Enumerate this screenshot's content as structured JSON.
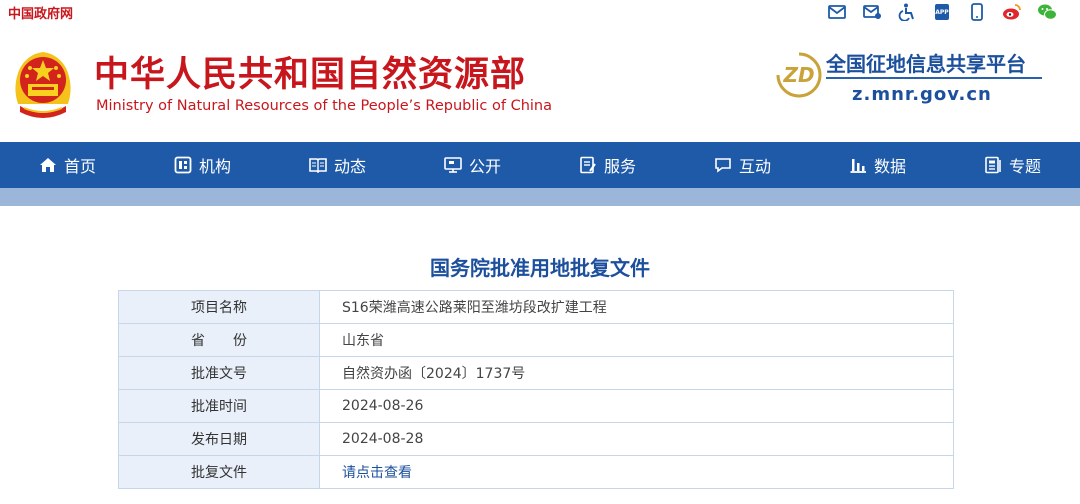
{
  "topbar": {
    "gov_link": "中国政府网",
    "icons": [
      "mail-icon",
      "mailbox-icon",
      "accessibility-icon",
      "app-icon",
      "mobile-icon",
      "weibo-icon",
      "wechat-icon"
    ]
  },
  "header": {
    "title_cn": "中华人民共和国自然资源部",
    "title_en": "Ministry of Natural Resources of the People’s Republic of China",
    "platform_logo_text": "ZD",
    "platform_name": "全国征地信息共享平台",
    "platform_url": "z.mnr.gov.cn"
  },
  "nav": {
    "items": [
      {
        "label": "首页",
        "icon": "home-icon"
      },
      {
        "label": "机构",
        "icon": "org-icon"
      },
      {
        "label": "动态",
        "icon": "book-icon"
      },
      {
        "label": "公开",
        "icon": "monitor-icon"
      },
      {
        "label": "服务",
        "icon": "clipboard-icon"
      },
      {
        "label": "互动",
        "icon": "chat-icon"
      },
      {
        "label": "数据",
        "icon": "chart-icon"
      },
      {
        "label": "专题",
        "icon": "document-icon"
      }
    ]
  },
  "main": {
    "title": "国务院批准用地批复文件",
    "rows": [
      {
        "label": "项目名称",
        "value": "S16荣潍高速公路莱阳至潍坊段改扩建工程"
      },
      {
        "label": "省　　份",
        "value": "山东省"
      },
      {
        "label": "批准文号",
        "value": "自然资办函〔2024〕1737号"
      },
      {
        "label": "批准时间",
        "value": "2024-08-26"
      },
      {
        "label": "发布日期",
        "value": "2024-08-28"
      },
      {
        "label": "批复文件",
        "value": "请点击查看"
      }
    ]
  },
  "colors": {
    "brand_red": "#c8161d",
    "nav_blue": "#1e5aa8",
    "nav_sub": "#9cb6d9",
    "table_label_bg": "#e9f0fa",
    "table_border": "#c6d7ec",
    "title_blue": "#1c4f9c"
  }
}
